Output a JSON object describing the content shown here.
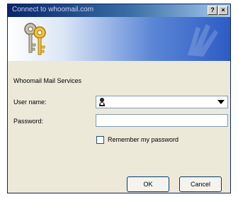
{
  "window": {
    "title": "Connect to whoomail.com",
    "help_label": "?",
    "close_label": "×"
  },
  "form": {
    "service_label": "Whoomail Mail Services",
    "user_name_label": "User name:",
    "user_name_value": "",
    "password_label": "Password:",
    "password_value": "",
    "remember_label": "Remember my password",
    "remember_checked": false
  },
  "buttons": {
    "ok": "OK",
    "cancel": "Cancel"
  },
  "icons": {
    "banner": "keys-icon",
    "user": "user-icon",
    "dropdown": "chevron-down-icon"
  },
  "colors": {
    "title_bar": "#0a246a",
    "banner_gradient_end": "#2d5cc4",
    "dialog_bg": "#ece9d8"
  }
}
